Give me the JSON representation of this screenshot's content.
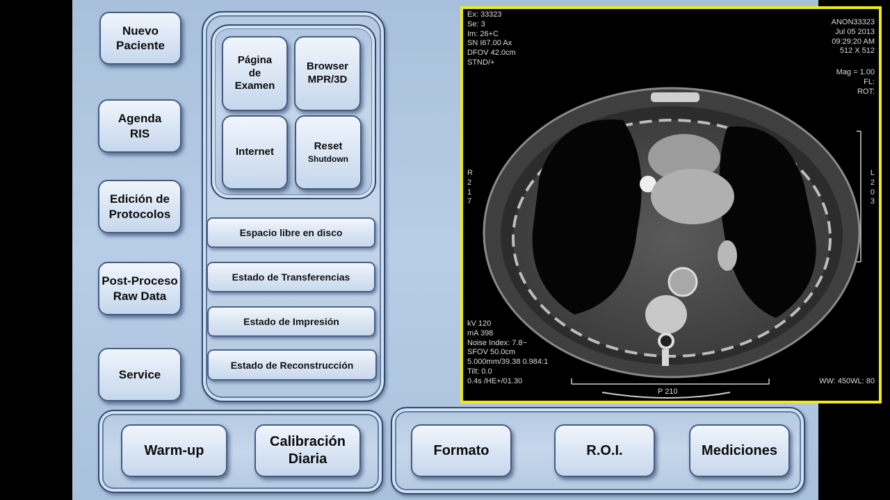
{
  "left_column": {
    "nuevo_paciente": [
      "Nuevo",
      "Paciente"
    ],
    "agenda_ris": [
      "Agenda",
      "RIS"
    ],
    "edicion_protocolos": [
      "Edición de",
      "Protocolos"
    ],
    "post_proceso": [
      "Post-Proceso",
      "Raw Data"
    ],
    "service": "Service"
  },
  "tools_panel": {
    "pagina_examen": [
      "Página",
      "de",
      "Examen"
    ],
    "browser_mpr": [
      "Browser",
      "MPR/3D"
    ],
    "internet": "Internet",
    "reset": "Reset",
    "shutdown": "Shutdown"
  },
  "status_bars": {
    "espacio": "Espacio libre en disco",
    "transferencias": "Estado de Transferencias",
    "impresion": "Estado de Impresión",
    "reconstruccion": "Estado de Reconstrucción"
  },
  "bottom_left": {
    "warmup": "Warm-up",
    "calibracion": [
      "Calibración",
      "Diaria"
    ]
  },
  "bottom_right": {
    "formato": "Formato",
    "roi": "R.O.I.",
    "mediciones": "Mediciones"
  },
  "viewer": {
    "border_color": "#f0ea10",
    "top_left": [
      "Ex: 33323",
      "Se: 3",
      "Im: 26+C",
      "SN I67.00 Ax",
      "DFOV 42.0cm",
      "STND/+"
    ],
    "top_right": [
      "ANON33323",
      "Jul 05 2013",
      "09:29:20 AM",
      "512 X 512"
    ],
    "top_right_2": [
      "Mag = 1.00",
      "FL:",
      "ROT:"
    ],
    "orient_left": [
      "R",
      "",
      "2",
      "1",
      "7"
    ],
    "orient_right": [
      "L",
      "",
      "2",
      "0",
      "3"
    ],
    "bottom_left": [
      "kV 120",
      "mA 398",
      "Noise Index: 7.8~",
      "SFOV 50.0cm",
      "5.000mm/39.38 0.984:1",
      "Tilt: 0.0",
      "0.4s /HE+/01.30"
    ],
    "window_level": "WW: 450WL: 80",
    "position_label": "P 210"
  }
}
